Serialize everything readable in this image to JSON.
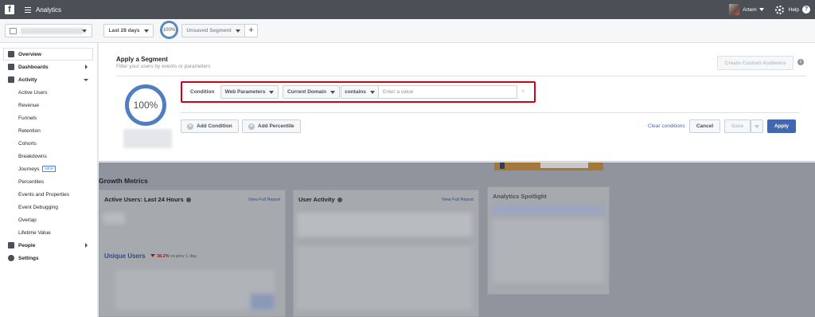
{
  "topbar": {
    "logo_letter": "f",
    "app_title": "Analytics",
    "user_name": "Artem",
    "help_label": "Help",
    "help_icon": "?"
  },
  "toolbar": {
    "date_range": "Last 28 days",
    "segment_percent": "100%",
    "segment_label": "Unsaved Segment",
    "add_label": "+"
  },
  "sidebar": {
    "items": [
      {
        "label": "Overview",
        "icon": "overview-icon"
      },
      {
        "label": "Dashboards",
        "icon": "dashboards-icon"
      },
      {
        "label": "Activity",
        "icon": "activity-icon"
      },
      {
        "label": "Active Users"
      },
      {
        "label": "Revenue"
      },
      {
        "label": "Funnels"
      },
      {
        "label": "Retention"
      },
      {
        "label": "Cohorts"
      },
      {
        "label": "Breakdowns"
      },
      {
        "label": "Journeys",
        "badge": "NEW"
      },
      {
        "label": "Percentiles"
      },
      {
        "label": "Events and Properties"
      },
      {
        "label": "Event Debugging"
      },
      {
        "label": "Overlap"
      },
      {
        "label": "Lifetime Value"
      },
      {
        "label": "People",
        "icon": "people-icon"
      },
      {
        "label": "Settings",
        "icon": "settings-icon"
      }
    ]
  },
  "segment_panel": {
    "title": "Apply a Segment",
    "subtitle": "Filter your users by events or parameters",
    "custom_audience": "Create Custom Audience",
    "percent": "100%",
    "condition_label": "Condition",
    "param_dropdown": "Web Parameters",
    "domain_dropdown": "Current Domain",
    "operator_dropdown": "contains",
    "value_placeholder": "Enter a value",
    "clear_x": "×",
    "add_condition": "Add Condition",
    "add_percentile": "Add Percentile",
    "clear_conditions": "Clear conditions",
    "cancel": "Cancel",
    "save": "Save",
    "apply": "Apply"
  },
  "dashboard": {
    "section_title": "Growth Metrics",
    "card1_title": "Active Users: Last 24 Hours",
    "card1_link": "View Full Report",
    "unique_users": "Unique Users",
    "delta_value": "38.2%",
    "delta_text": "vs prev 1 day",
    "card2_title": "User Activity",
    "card2_link": "View Full Report",
    "spotlight_title": "Analytics Spotlight"
  },
  "colors": {
    "topbar": "#4b4f56",
    "accent": "#4267b2",
    "highlight_border": "#d0021b",
    "ring": "#4f7fc0"
  }
}
